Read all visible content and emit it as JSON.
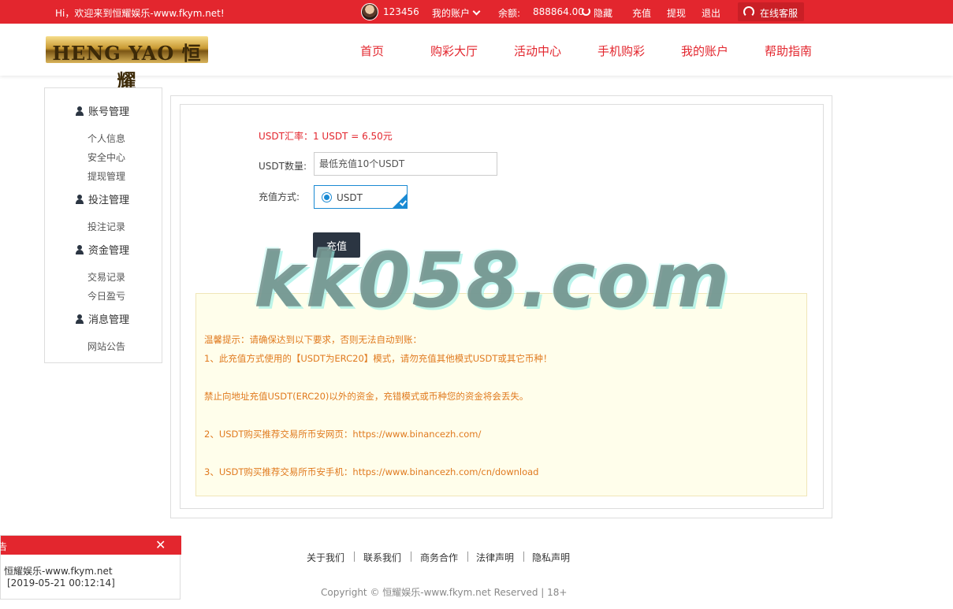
{
  "topbar": {
    "welcome": "Hi，欢迎来到恒耀娱乐-www.fkym.net!",
    "username": "123456",
    "my_account": "我的账户",
    "balance_label": "余额:",
    "balance_value": "888864.00",
    "hide": "隐藏",
    "recharge": "充值",
    "withdraw": "提现",
    "logout": "退出",
    "support": "在线客服"
  },
  "header": {
    "logo_text": "HENG YAO 恒耀",
    "nav": [
      "首页",
      "购彩大厅",
      "活动中心",
      "手机购彩",
      "我的账户",
      "帮助指南"
    ]
  },
  "sidebar": {
    "sections": [
      {
        "title": "账号管理",
        "items": [
          "个人信息",
          "安全中心",
          "提现管理"
        ]
      },
      {
        "title": "投注管理",
        "items": [
          "投注记录"
        ]
      },
      {
        "title": "资金管理",
        "items": [
          "交易记录",
          "今日盈亏"
        ]
      },
      {
        "title": "消息管理",
        "items": [
          "网站公告"
        ]
      }
    ]
  },
  "form": {
    "rate": "USDT汇率：1 USDT = 6.50元",
    "qty_label": "USDT数量:",
    "qty_placeholder": "最低充值10个USDT",
    "method_label": "充值方式:",
    "method_option": "USDT",
    "submit": "充值"
  },
  "notice": {
    "lines": [
      "温馨提示：请确保达到以下要求，否则无法自动到账：",
      "1、此充值方式使用的【USDT为ERC20】模式，请勿充值其他模式USDT或其它币种！",
      "禁止向地址充值USDT(ERC20)以外的资金，充错模式或币种您的资金将会丢失。",
      "2、USDT购买推荐交易所币安网页：https://www.binancezh.com/",
      "3、USDT购买推荐交易所币安手机：https://www.binancezh.com/cn/download"
    ]
  },
  "watermark": "kk058.com",
  "footer": {
    "links": [
      "关于我们",
      "联系我们",
      "商务合作",
      "法律声明",
      "隐私声明"
    ],
    "copyright": "Copyright © 恒耀娱乐-www.fkym.net Reserved | 18+"
  },
  "popup": {
    "title": "告",
    "close": "✕",
    "line1": "恒耀娱乐-www.fkym.net",
    "line2": "[2019-05-21 00:12:14]"
  }
}
